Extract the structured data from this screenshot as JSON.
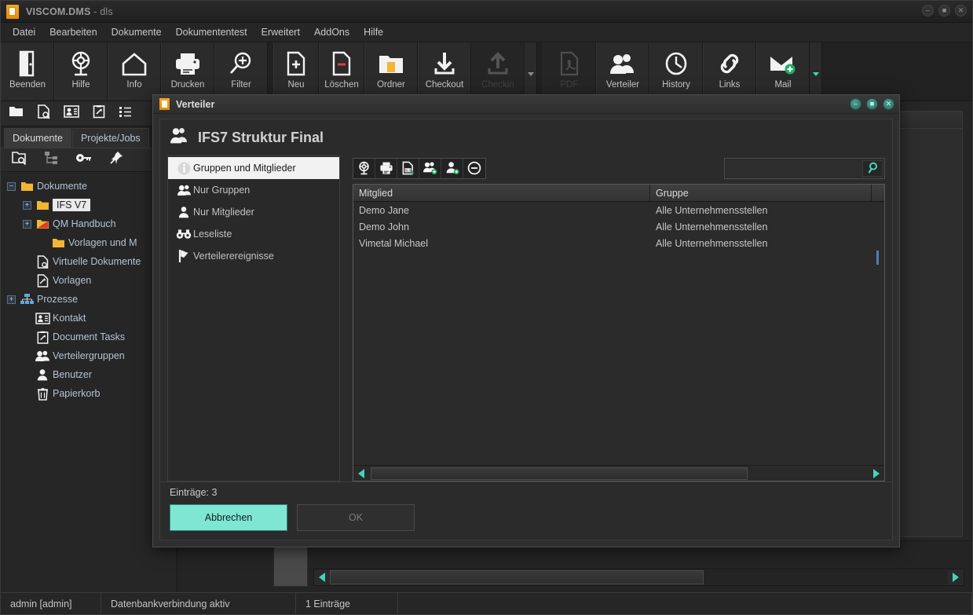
{
  "window": {
    "title": "VISCOM.DMS",
    "title_sub": "- dls",
    "app_icon": "document-icon",
    "controls": [
      {
        "name": "minimize-button",
        "glyph": "–"
      },
      {
        "name": "maximize-button",
        "glyph": "■"
      },
      {
        "name": "close-button",
        "glyph": "✕"
      }
    ]
  },
  "menubar": {
    "items": [
      {
        "label": "Datei"
      },
      {
        "label": "Bearbeiten"
      },
      {
        "label": "Dokumente"
      },
      {
        "label": "Dokumententest"
      },
      {
        "label": "Erweitert"
      },
      {
        "label": "AddOns"
      },
      {
        "label": "Hilfe"
      }
    ]
  },
  "ribbon": {
    "buttons": [
      {
        "label": "Beenden",
        "icon": "exit-door-icon",
        "disabled": false
      },
      {
        "label": "Hilfe",
        "icon": "lifebuoy-icon",
        "disabled": false
      },
      {
        "label": "Info",
        "icon": "home-icon",
        "disabled": false
      },
      {
        "label": "Drucken",
        "icon": "printer-icon",
        "disabled": false
      },
      {
        "label": "Filter",
        "icon": "magnifier-plus-icon",
        "disabled": false
      },
      {
        "label": "Neu",
        "icon": "document-plus-icon",
        "disabled": false
      },
      {
        "label": "Löschen",
        "icon": "document-minus-icon",
        "disabled": false
      },
      {
        "label": "Ordner",
        "icon": "folder-document-icon",
        "disabled": false
      },
      {
        "label": "Checkout",
        "icon": "download-arrow-icon",
        "disabled": false
      },
      {
        "label": "Checkin",
        "icon": "upload-arrow-icon",
        "disabled": true
      },
      {
        "label": "PDF",
        "icon": "pdf-file-icon",
        "disabled": true
      },
      {
        "label": "Verteiler",
        "icon": "users-group-icon",
        "disabled": false
      },
      {
        "label": "History",
        "icon": "clock-icon",
        "disabled": false
      },
      {
        "label": "Links",
        "icon": "chain-link-icon",
        "disabled": false
      },
      {
        "label": "Mail",
        "icon": "envelope-plus-icon",
        "disabled": false
      }
    ]
  },
  "sidebar": {
    "toolbar_icons": [
      "folder-icon",
      "document-search-icon",
      "contact-card-icon",
      "clipboard-edit-icon",
      "list-icon"
    ],
    "tabs": [
      {
        "label": "Dokumente",
        "active": true
      },
      {
        "label": "Projekte/Jobs",
        "active": false
      }
    ],
    "tree_toolbar_icons": [
      "folder-search-icon",
      "tree-structure-icon",
      "key-icon",
      "pin-icon"
    ],
    "tree": [
      {
        "label": "Dokumente",
        "icon": "folder-open-icon",
        "expander": "−",
        "indent": 1,
        "selected": false
      },
      {
        "label": "IFS V7",
        "icon": "folder-icon",
        "expander": "+",
        "indent": 2,
        "selected": true
      },
      {
        "label": "QM Handbuch",
        "icon": "folder-red-icon",
        "expander": "+",
        "indent": 2,
        "selected": false
      },
      {
        "label": "Vorlagen und M",
        "icon": "folder-icon",
        "expander": "",
        "indent": 3,
        "selected": false
      },
      {
        "label": "Virtuelle Dokumente",
        "icon": "document-search-icon",
        "expander": "",
        "indent": 2,
        "selected": false
      },
      {
        "label": "Vorlagen",
        "icon": "template-icon",
        "expander": "",
        "indent": 2,
        "selected": false
      },
      {
        "label": "Prozesse",
        "icon": "process-tree-icon",
        "expander": "+",
        "indent": 1,
        "selected": false
      },
      {
        "label": "Kontakt",
        "icon": "contact-card-icon",
        "expander": "",
        "indent": 2,
        "selected": false
      },
      {
        "label": "Document Tasks",
        "icon": "clipboard-edit-icon",
        "expander": "",
        "indent": 2,
        "selected": false
      },
      {
        "label": "Verteilergruppen",
        "icon": "users-group-icon",
        "expander": "",
        "indent": 2,
        "selected": false
      },
      {
        "label": "Benutzer",
        "icon": "user-icon",
        "expander": "",
        "indent": 2,
        "selected": false
      },
      {
        "label": "Papierkorb",
        "icon": "trash-icon",
        "expander": "",
        "indent": 2,
        "selected": false
      }
    ]
  },
  "statusbar": {
    "user": "admin [admin]",
    "connection": "Datenbankverbindung aktiv",
    "entries": "1 Einträge"
  },
  "dialog": {
    "title": "Verteiler",
    "title_icon": "document-icon",
    "controls": [
      {
        "name": "dialog-minimize-button",
        "glyph": "–"
      },
      {
        "name": "dialog-maximize-button",
        "glyph": "■"
      },
      {
        "name": "dialog-close-button",
        "glyph": "✕"
      }
    ],
    "heading": "IFS7 Struktur Final",
    "heading_icon": "users-group-icon",
    "nav": [
      {
        "label": "Gruppen und Mitglieder",
        "icon": "info-icon",
        "active": true
      },
      {
        "label": "Nur Gruppen",
        "icon": "users-group-icon",
        "active": false
      },
      {
        "label": "Nur Mitglieder",
        "icon": "user-icon",
        "active": false
      },
      {
        "label": "Leseliste",
        "icon": "binoculars-icon",
        "active": false
      },
      {
        "label": "Verteilerereignisse",
        "icon": "flag-icon",
        "active": false
      }
    ],
    "toolbar": [
      {
        "name": "refresh-lifebuoy-button",
        "icon": "lifebuoy-stand-icon"
      },
      {
        "name": "print-button",
        "icon": "printer-icon"
      },
      {
        "name": "export-xls-button",
        "icon": "export-xls-icon"
      },
      {
        "name": "add-group-button",
        "icon": "add-group-icon"
      },
      {
        "name": "add-member-button",
        "icon": "add-member-icon"
      },
      {
        "name": "remove-button",
        "icon": "minus-circle-icon"
      }
    ],
    "search": {
      "value": "",
      "placeholder": "",
      "icon": "search-icon"
    },
    "table": {
      "columns": [
        "Mitglied",
        "Gruppe"
      ],
      "rows": [
        [
          "Demo Jane",
          "Alle Unternehmensstellen"
        ],
        [
          "Demo John",
          "Alle Unternehmensstellen"
        ],
        [
          "Vimetal Michael",
          "Alle Unternehmensstellen"
        ]
      ]
    },
    "entries_label": "Einträge: 3",
    "buttons": {
      "cancel": "Abbrechen",
      "ok": "OK"
    }
  },
  "colors": {
    "accent": "#7fe6d2",
    "scroll_arrow": "#3fd6bd",
    "folder": "#f2b632",
    "selection_bg": "#e9e9e9"
  }
}
